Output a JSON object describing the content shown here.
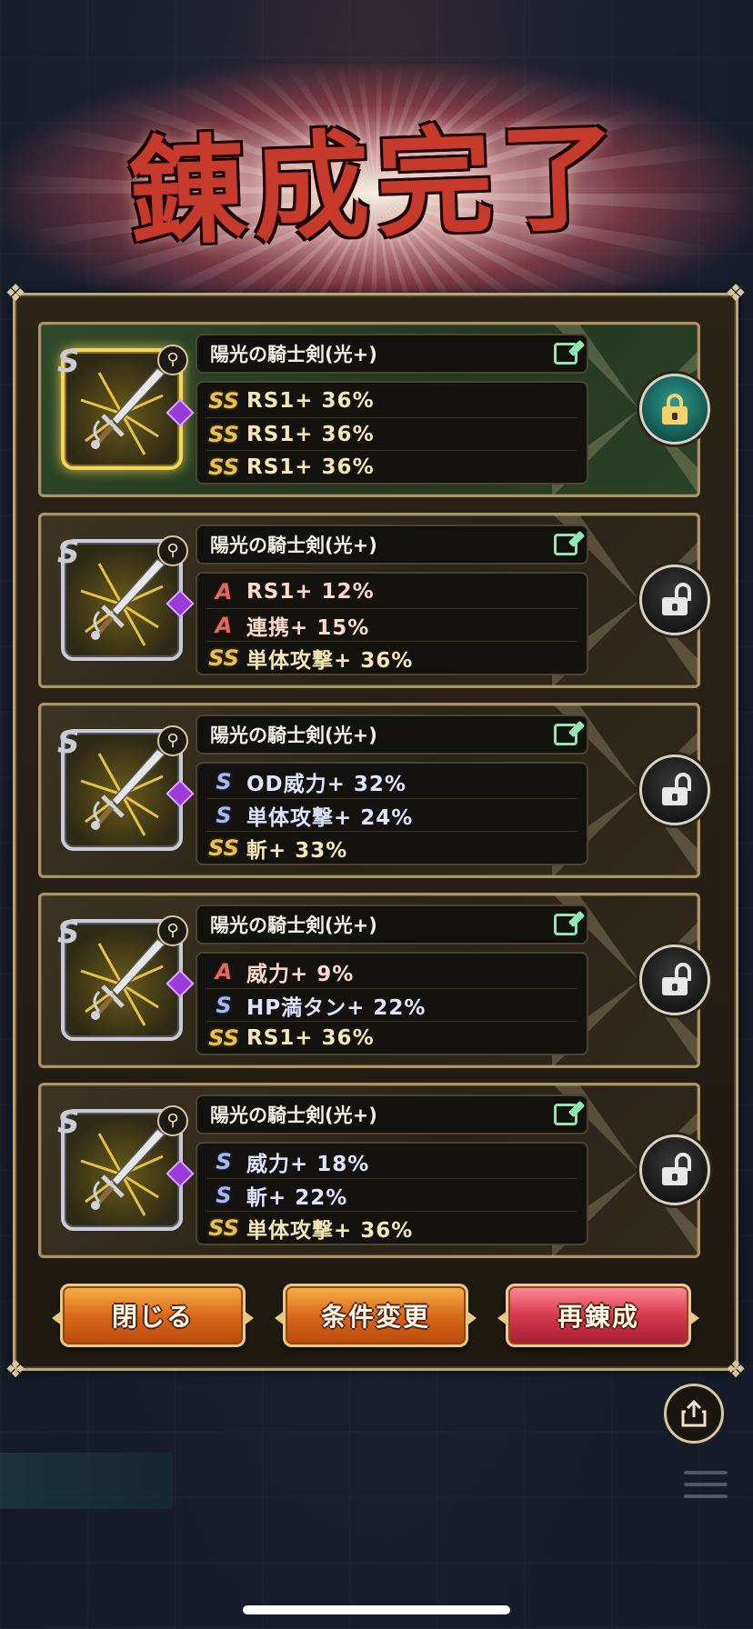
{
  "title": "錬成完了",
  "colors": {
    "accent_gold": "#d8c79b",
    "locked_card": "#233820",
    "button_orange": "#d96a1a",
    "button_red": "#d63a50"
  },
  "items": [
    {
      "name": "陽光の騎士剣(光+)",
      "locked": true,
      "lock_icon": "padlock-closed-icon",
      "stats": [
        {
          "rank": "SS",
          "text": "RS1+ 36%"
        },
        {
          "rank": "SS",
          "text": "RS1+ 36%"
        },
        {
          "rank": "SS",
          "text": "RS1+ 36%"
        }
      ]
    },
    {
      "name": "陽光の騎士剣(光+)",
      "locked": false,
      "lock_icon": "padlock-open-icon",
      "stats": [
        {
          "rank": "A",
          "text": "RS1+ 12%"
        },
        {
          "rank": "A",
          "text": "連携+ 15%"
        },
        {
          "rank": "SS",
          "text": "単体攻撃+ 36%"
        }
      ]
    },
    {
      "name": "陽光の騎士剣(光+)",
      "locked": false,
      "lock_icon": "padlock-open-icon",
      "stats": [
        {
          "rank": "S",
          "text": "OD威力+ 32%"
        },
        {
          "rank": "S",
          "text": "単体攻撃+ 24%"
        },
        {
          "rank": "SS",
          "text": "斬+ 33%"
        }
      ]
    },
    {
      "name": "陽光の騎士剣(光+)",
      "locked": false,
      "lock_icon": "padlock-open-icon",
      "stats": [
        {
          "rank": "A",
          "text": "威力+ 9%"
        },
        {
          "rank": "S",
          "text": "HP満タン+ 22%"
        },
        {
          "rank": "SS",
          "text": "RS1+ 36%"
        }
      ]
    },
    {
      "name": "陽光の騎士剣(光+)",
      "locked": false,
      "lock_icon": "padlock-open-icon",
      "stats": [
        {
          "rank": "S",
          "text": "威力+ 18%"
        },
        {
          "rank": "S",
          "text": "斬+ 22%"
        },
        {
          "rank": "SS",
          "text": "単体攻撃+ 36%"
        }
      ]
    }
  ],
  "buttons": {
    "close": "閉じる",
    "change_conditions": "条件変更",
    "reforge": "再錬成"
  },
  "icons": {
    "edit": "edit-icon",
    "share": "share-icon",
    "menu": "menu-icon",
    "weapon": "sword-icon"
  }
}
